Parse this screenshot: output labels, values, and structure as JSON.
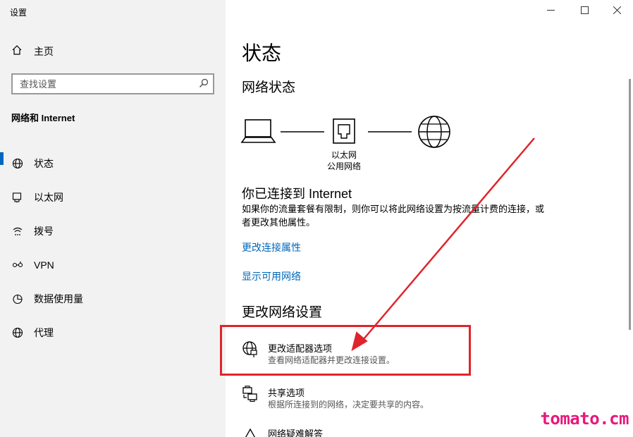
{
  "window": {
    "title": "设置",
    "controls": [
      "minimize-icon",
      "maximize-icon",
      "close-icon"
    ]
  },
  "sidebar": {
    "home_label": "主页",
    "search_placeholder": "查找设置",
    "section_title": "网络和 Internet",
    "selected": "状态",
    "items": [
      {
        "label": "状态",
        "icon": "status-icon"
      },
      {
        "label": "以太网",
        "icon": "ethernet-icon"
      },
      {
        "label": "拨号",
        "icon": "dialup-icon"
      },
      {
        "label": "VPN",
        "icon": "vpn-icon"
      },
      {
        "label": "数据使用量",
        "icon": "data-usage-icon"
      },
      {
        "label": "代理",
        "icon": "proxy-icon"
      }
    ]
  },
  "main": {
    "title": "状态",
    "network_status_heading": "网络状态",
    "diagram": {
      "adapter_name": "以太网",
      "network_type": "公用网络"
    },
    "connected_title": "你已连接到 Internet",
    "connected_desc": "如果你的流量套餐有限制，则你可以将此网络设置为按流量计费的连接，或者更改其他属性。",
    "links": {
      "change_properties": "更改连接属性",
      "show_networks": "显示可用网络"
    },
    "change_settings_heading": "更改网络设置",
    "settings": [
      {
        "title": "更改适配器选项",
        "subtitle": "查看网络适配器并更改连接设置。",
        "icon": "adapter-icon"
      },
      {
        "title": "共享选项",
        "subtitle": "根据所连接到的网络，决定要共享的内容。",
        "icon": "sharing-icon"
      },
      {
        "title": "网络疑难解答",
        "icon": "troubleshoot-icon"
      }
    ]
  },
  "annotation": {
    "color": "#e0242b"
  },
  "watermark": "tomato.cm",
  "colors": {
    "accent": "#0067c0",
    "link": "#0067b8",
    "sidebar_bg": "#f2f2f2"
  }
}
